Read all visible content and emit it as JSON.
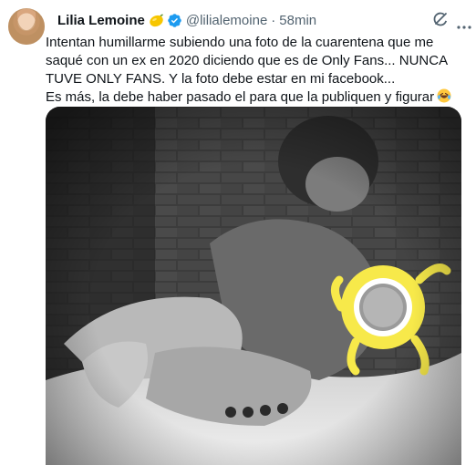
{
  "tweet": {
    "author_name": "Lilia Lemoine",
    "author_handle": "@lilialemoine",
    "separator": "·",
    "timestamp": "58min",
    "text_line1": "Intentan humillarme subiendo una foto de la cuarentena que me saqué con un ex en 2020 diciendo que es de Only Fans... NUNCA TUVE ONLY FANS. Y la foto debe estar en mi facebook...",
    "text_line2": "Es más, la debe haber pasado el para que la publiquen y figurar"
  },
  "icons": {
    "name_emoji": "lemon-emoji-icon",
    "verified": "verified-badge-icon",
    "grok": "grok-icon",
    "more": "more-options-icon",
    "text_emoji": "rolling-laughing-emoji-icon"
  },
  "colors": {
    "verified_blue": "#1d9bf0",
    "text": "#0f1419",
    "secondary": "#536471"
  }
}
